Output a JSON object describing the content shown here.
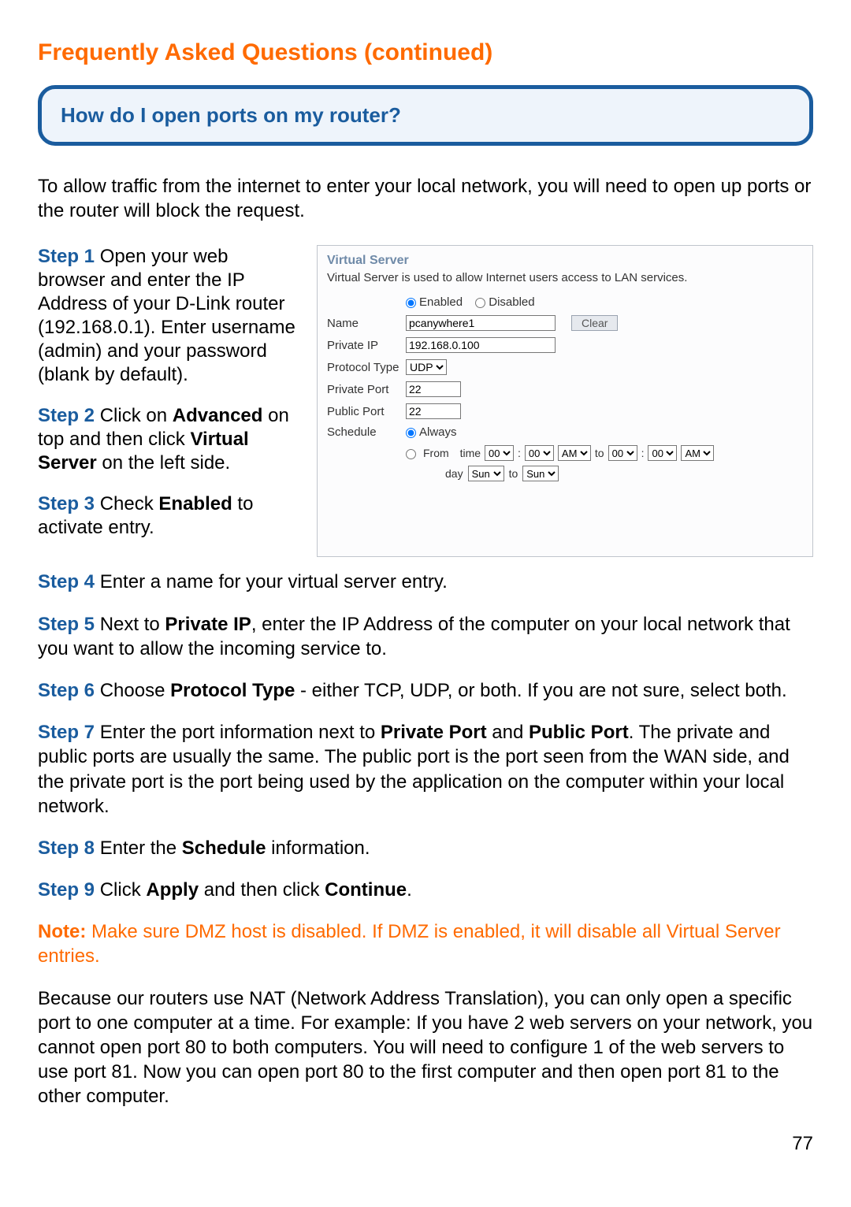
{
  "page": {
    "title": "Frequently Asked Questions (continued)",
    "question": "How do I open ports on my router?",
    "intro": "To allow traffic from the internet to enter your local network, you will need to open up ports or the router will block the request.",
    "page_number": "77"
  },
  "steps": {
    "s1": {
      "label": "Step 1",
      "text_a": " Open your web browser and enter the IP Address of your D-Link router (192.168.0.1). Enter username (admin) and your password (blank by default)."
    },
    "s2": {
      "label": "Step 2",
      "text_a": " Click on ",
      "bold1": "Advanced",
      "text_b": " on top and then click ",
      "bold2": "Virtual Server",
      "text_c": " on the left side."
    },
    "s3": {
      "label": "Step 3",
      "text_a": " Check ",
      "bold1": "Enabled",
      "text_b": " to activate entry."
    },
    "s4": {
      "label": "Step 4",
      "text_a": " Enter a name for your virtual server entry."
    },
    "s5": {
      "label": "Step 5",
      "text_a": " Next to ",
      "bold1": "Private IP",
      "text_b": ", enter the IP Address of the computer on your local network that you want to allow the incoming service to."
    },
    "s6": {
      "label": "Step 6",
      "text_a": " Choose ",
      "bold1": "Protocol Type",
      "text_b": " - either TCP, UDP, or both. If you are not sure, select both."
    },
    "s7": {
      "label": "Step 7",
      "text_a": "  Enter the port information next to ",
      "bold1": "Private Port",
      "text_b": " and ",
      "bold2": "Public Port",
      "text_c": ". The private and public ports are usually the same. The public port is the port seen from the WAN side, and the private port is the port being used by the application on the computer within your local network."
    },
    "s8": {
      "label": "Step 8",
      "text_a": "  Enter the ",
      "bold1": "Schedule",
      "text_b": " information."
    },
    "s9": {
      "label": "Step 9",
      "text_a": "  Click ",
      "bold1": "Apply",
      "text_b": " and then click ",
      "bold2": "Continue",
      "text_c": "."
    }
  },
  "note": {
    "label": "Note:",
    "text": " Make sure DMZ host is disabled. If DMZ is enabled, it will disable all Virtual Server entries."
  },
  "closing": "Because our routers use NAT (Network Address Translation), you can only open a specific port to one computer at a time. For example: If you have 2 web servers on your network, you cannot open port 80 to both computers. You will need to configure 1 of the web servers to use port 81. Now you can open port 80 to the first computer and then open port 81 to the other computer.",
  "vs": {
    "title": "Virtual Server",
    "desc": "Virtual Server is used to allow Internet users access to LAN services.",
    "enabled": "Enabled",
    "disabled": "Disabled",
    "labels": {
      "name": "Name",
      "private_ip": "Private IP",
      "protocol_type": "Protocol Type",
      "private_port": "Private Port",
      "public_port": "Public Port",
      "schedule": "Schedule"
    },
    "values": {
      "name": "pcanywhere1",
      "private_ip": "192.168.0.100",
      "protocol": "UDP",
      "private_port": "22",
      "public_port": "22"
    },
    "clear": "Clear",
    "schedule": {
      "always": "Always",
      "from": "From",
      "time": "time",
      "h1": "00",
      "m1": "00",
      "ap1": "AM",
      "to": "to",
      "h2": "00",
      "m2": "00",
      "ap2": "AM",
      "day": "day",
      "d1": "Sun",
      "to2": "to",
      "d2": "Sun"
    }
  }
}
